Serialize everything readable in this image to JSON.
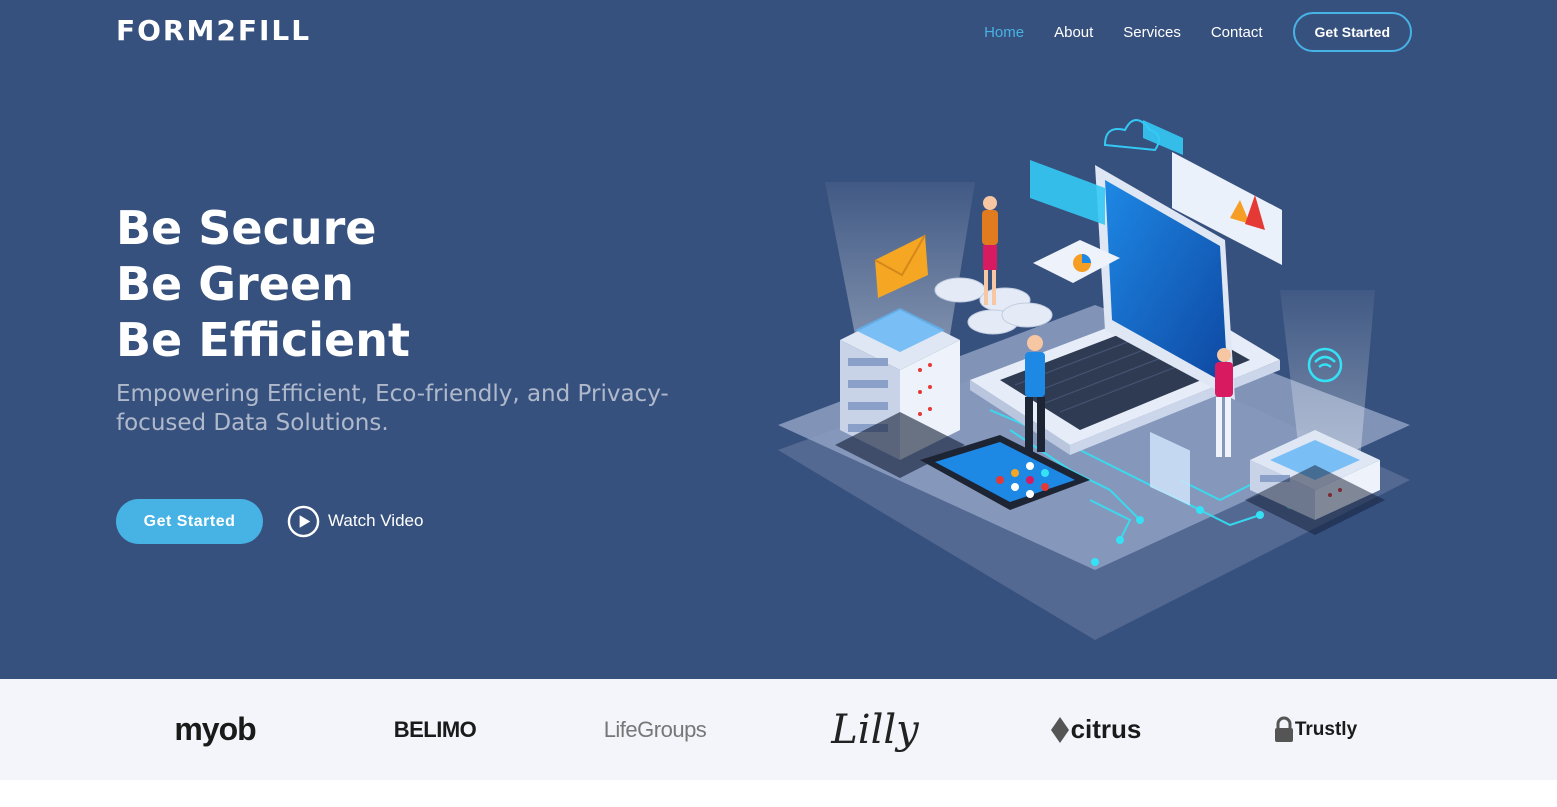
{
  "header": {
    "logo": "FORM2FILL",
    "nav": [
      {
        "label": "Home",
        "active": true
      },
      {
        "label": "About",
        "active": false
      },
      {
        "label": "Services",
        "active": false
      },
      {
        "label": "Contact",
        "active": false
      }
    ],
    "cta": "Get Started"
  },
  "hero": {
    "headline": [
      "Be Secure",
      "Be Green",
      "Be Efficient"
    ],
    "subtitle": "Empowering Efficient, Eco-friendly, and Privacy-focused Data Solutions.",
    "primary_button": "Get Started",
    "video_link": "Watch Video"
  },
  "clients": [
    "myob",
    "BELIMO",
    "LifeGroups",
    "Lilly",
    "citrus",
    "Trustly"
  ],
  "colors": {
    "hero_bg": "#37517e",
    "accent": "#47b2e4",
    "clients_bg": "#f3f5fa"
  }
}
